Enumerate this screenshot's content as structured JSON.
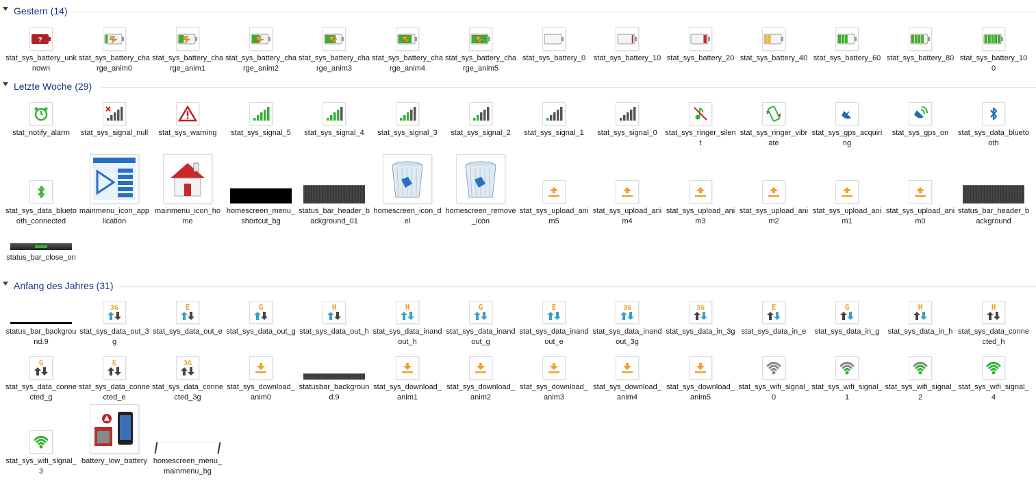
{
  "groups": [
    {
      "title": "Gestern (14)",
      "items": [
        {
          "label": "stat_sys_battery_unknown",
          "icon": "battery-unknown-icon",
          "kind": "batq"
        },
        {
          "label": "stat_sys_battery_charge_anim0",
          "icon": "battery-charge-icon",
          "kind": "chg",
          "level": 0
        },
        {
          "label": "stat_sys_battery_charge_anim1",
          "icon": "battery-charge-icon",
          "kind": "chg",
          "level": 1
        },
        {
          "label": "stat_sys_battery_charge_anim2",
          "icon": "battery-charge-icon",
          "kind": "chg",
          "level": 2
        },
        {
          "label": "stat_sys_battery_charge_anim3",
          "icon": "battery-charge-icon",
          "kind": "chg",
          "level": 3
        },
        {
          "label": "stat_sys_battery_charge_anim4",
          "icon": "battery-charge-icon",
          "kind": "chg",
          "level": 4
        },
        {
          "label": "stat_sys_battery_charge_anim5",
          "icon": "battery-charge-icon",
          "kind": "chg",
          "level": 5
        },
        {
          "label": "stat_sys_battery_0",
          "icon": "battery-icon",
          "kind": "bat",
          "level": 0
        },
        {
          "label": "stat_sys_battery_10",
          "icon": "battery-icon",
          "kind": "bat",
          "level": 10
        },
        {
          "label": "stat_sys_battery_20",
          "icon": "battery-icon",
          "kind": "bat",
          "level": 20
        },
        {
          "label": "stat_sys_battery_40",
          "icon": "battery-icon",
          "kind": "bat",
          "level": 40
        },
        {
          "label": "stat_sys_battery_60",
          "icon": "battery-icon",
          "kind": "bat",
          "level": 60
        },
        {
          "label": "stat_sys_battery_80",
          "icon": "battery-icon",
          "kind": "bat",
          "level": 80
        },
        {
          "label": "stat_sys_battery_100",
          "icon": "battery-icon",
          "kind": "bat",
          "level": 100
        }
      ]
    },
    {
      "title": "Letzte Woche (29)",
      "items": [
        {
          "label": "stat_notify_alarm",
          "icon": "alarm-clock-icon",
          "kind": "alarm"
        },
        {
          "label": "stat_sys_signal_null",
          "icon": "signal-null-icon",
          "kind": "signull"
        },
        {
          "label": "stat_sys_warning",
          "icon": "warning-icon",
          "kind": "warn"
        },
        {
          "label": "stat_sys_signal_5",
          "icon": "signal-icon",
          "kind": "sig",
          "level": 5
        },
        {
          "label": "stat_sys_signal_4",
          "icon": "signal-icon",
          "kind": "sig",
          "level": 4
        },
        {
          "label": "stat_sys_signal_3",
          "icon": "signal-icon",
          "kind": "sig",
          "level": 3
        },
        {
          "label": "stat_sys_signal_2",
          "icon": "signal-icon",
          "kind": "sig",
          "level": 2
        },
        {
          "label": "stat_sys_signal_1",
          "icon": "signal-icon",
          "kind": "sig",
          "level": 1
        },
        {
          "label": "stat_sys_signal_0",
          "icon": "signal-icon",
          "kind": "sig",
          "level": 0
        },
        {
          "label": "stat_sys_ringer_silent",
          "icon": "ringer-silent-icon",
          "kind": "silent"
        },
        {
          "label": "stat_sys_ringer_vibrate",
          "icon": "ringer-vibrate-icon",
          "kind": "vibrate"
        },
        {
          "label": "stat_sys_gps_acquiring",
          "icon": "gps-acquiring-icon",
          "kind": "gpsacq"
        },
        {
          "label": "stat_sys_gps_on",
          "icon": "gps-on-icon",
          "kind": "gpson"
        },
        {
          "label": "stat_sys_data_bluetooth",
          "icon": "bluetooth-icon",
          "kind": "bt"
        },
        {
          "label": "stat_sys_data_bluetooth_connected",
          "icon": "bluetooth-connected-icon",
          "kind": "btc"
        },
        {
          "label": "mainmenu_icon_application",
          "icon": "application-icon",
          "kind": "app"
        },
        {
          "label": "mainmenu_icon_home",
          "icon": "home-icon",
          "kind": "home"
        },
        {
          "label": "homescreen_menu_shortcut_bg",
          "icon": "black-bar-icon",
          "kind": "blackbar"
        },
        {
          "label": "status_bar_header_background_01",
          "icon": "status-bar-strip-icon",
          "kind": "darkstrip"
        },
        {
          "label": "homescreen_icon_del",
          "icon": "recycle-bin-icon",
          "kind": "trash"
        },
        {
          "label": "homescreen_remove_icon",
          "icon": "recycle-bin-icon",
          "kind": "trash"
        },
        {
          "label": "stat_sys_upload_anim5",
          "icon": "upload-icon",
          "kind": "up"
        },
        {
          "label": "stat_sys_upload_anim4",
          "icon": "upload-icon",
          "kind": "up"
        },
        {
          "label": "stat_sys_upload_anim3",
          "icon": "upload-icon",
          "kind": "up"
        },
        {
          "label": "stat_sys_upload_anim2",
          "icon": "upload-icon",
          "kind": "up"
        },
        {
          "label": "stat_sys_upload_anim1",
          "icon": "upload-icon",
          "kind": "up"
        },
        {
          "label": "stat_sys_upload_anim0",
          "icon": "upload-icon",
          "kind": "up"
        },
        {
          "label": "status_bar_header_background",
          "icon": "status-bar-strip-icon",
          "kind": "darkstrip"
        },
        {
          "label": "status_bar_close_on",
          "icon": "close-bar-icon",
          "kind": "closebar"
        }
      ]
    },
    {
      "title": "Anfang des Jahres (31)",
      "items": [
        {
          "label": "status_bar_background.9",
          "icon": "thin-bar-icon",
          "kind": "thinbar"
        },
        {
          "label": "stat_sys_data_out_3g",
          "icon": "data-out-3g-icon",
          "kind": "data",
          "net": "3G",
          "up": "#3aa0c8",
          "down": "#444444"
        },
        {
          "label": "stat_sys_data_out_e",
          "icon": "data-out-e-icon",
          "kind": "data",
          "net": "E",
          "up": "#3aa0c8",
          "down": "#444444"
        },
        {
          "label": "stat_sys_data_out_g",
          "icon": "data-out-g-icon",
          "kind": "data",
          "net": "G",
          "up": "#3aa0c8",
          "down": "#444444"
        },
        {
          "label": "stat_sys_data_out_h",
          "icon": "data-out-h-icon",
          "kind": "data",
          "net": "H",
          "up": "#3aa0c8",
          "down": "#444444"
        },
        {
          "label": "stat_sys_data_inandout_h",
          "icon": "data-inandout-h-icon",
          "kind": "data",
          "net": "H",
          "up": "#3aa0c8",
          "down": "#3aa0c8"
        },
        {
          "label": "stat_sys_data_inandout_g",
          "icon": "data-inandout-g-icon",
          "kind": "data",
          "net": "G",
          "up": "#3aa0c8",
          "down": "#3aa0c8"
        },
        {
          "label": "stat_sys_data_inandout_e",
          "icon": "data-inandout-e-icon",
          "kind": "data",
          "net": "E",
          "up": "#3aa0c8",
          "down": "#3aa0c8"
        },
        {
          "label": "stat_sys_data_inandout_3g",
          "icon": "data-inandout-3g-icon",
          "kind": "data",
          "net": "3G",
          "up": "#3aa0c8",
          "down": "#3aa0c8"
        },
        {
          "label": "stat_sys_data_in_3g",
          "icon": "data-in-3g-icon",
          "kind": "data",
          "net": "3G",
          "up": "#444444",
          "down": "#3aa0c8"
        },
        {
          "label": "stat_sys_data_in_e",
          "icon": "data-in-e-icon",
          "kind": "data",
          "net": "E",
          "up": "#444444",
          "down": "#3aa0c8"
        },
        {
          "label": "stat_sys_data_in_g",
          "icon": "data-in-g-icon",
          "kind": "data",
          "net": "G",
          "up": "#444444",
          "down": "#3aa0c8"
        },
        {
          "label": "stat_sys_data_in_h",
          "icon": "data-in-h-icon",
          "kind": "data",
          "net": "H",
          "up": "#444444",
          "down": "#3aa0c8"
        },
        {
          "label": "stat_sys_data_connected_h",
          "icon": "data-connected-h-icon",
          "kind": "data",
          "net": "H",
          "up": "#444444",
          "down": "#444444"
        },
        {
          "label": "stat_sys_data_connected_g",
          "icon": "data-connected-g-icon",
          "kind": "data",
          "net": "G",
          "up": "#444444",
          "down": "#444444"
        },
        {
          "label": "stat_sys_data_connected_e",
          "icon": "data-connected-e-icon",
          "kind": "data",
          "net": "E",
          "up": "#444444",
          "down": "#444444"
        },
        {
          "label": "stat_sys_data_connected_3g",
          "icon": "data-connected-3g-icon",
          "kind": "data",
          "net": "3G",
          "up": "#444444",
          "down": "#444444"
        },
        {
          "label": "stat_sys_download_anim0",
          "icon": "download-icon",
          "kind": "down"
        },
        {
          "label": "statusbar_background.9",
          "icon": "status-bar-strip-icon",
          "kind": "darkstrip2"
        },
        {
          "label": "stat_sys_download_anim1",
          "icon": "download-icon",
          "kind": "down"
        },
        {
          "label": "stat_sys_download_anim2",
          "icon": "download-icon",
          "kind": "down"
        },
        {
          "label": "stat_sys_download_anim3",
          "icon": "download-icon",
          "kind": "down"
        },
        {
          "label": "stat_sys_download_anim4",
          "icon": "download-icon",
          "kind": "down"
        },
        {
          "label": "stat_sys_download_anim5",
          "icon": "download-icon",
          "kind": "down"
        },
        {
          "label": "stat_sys_wifi_signal_0",
          "icon": "wifi-icon",
          "kind": "wifi",
          "level": 0
        },
        {
          "label": "stat_sys_wifi_signal_1",
          "icon": "wifi-icon",
          "kind": "wifi",
          "level": 1
        },
        {
          "label": "stat_sys_wifi_signal_2",
          "icon": "wifi-icon",
          "kind": "wifi",
          "level": 2
        },
        {
          "label": "stat_sys_wifi_signal_4",
          "icon": "wifi-icon",
          "kind": "wifi",
          "level": 4
        },
        {
          "label": "stat_sys_wifi_signal_3",
          "icon": "wifi-icon",
          "kind": "wifi",
          "level": 3
        },
        {
          "label": "battery_low_battery",
          "icon": "battery-low-phone-icon",
          "kind": "lowbat"
        },
        {
          "label": "homescreen_menu_mainmenu_bg",
          "icon": "menu-bg-icon",
          "kind": "menubg"
        }
      ]
    }
  ],
  "colors": {
    "header_text": "#1e3287",
    "accent_orange": "#f0a030",
    "signal_green": "#33b233"
  }
}
